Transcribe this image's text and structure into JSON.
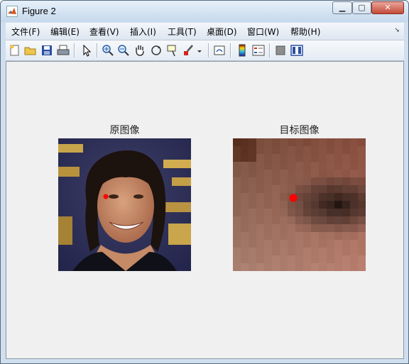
{
  "window": {
    "title": "Figure 2"
  },
  "menu": {
    "items": [
      "文件(F)",
      "编辑(E)",
      "查看(V)",
      "插入(I)",
      "工具(T)",
      "桌面(D)",
      "窗口(W)",
      "帮助(H)"
    ]
  },
  "toolbar_icons": [
    "new-figure-icon",
    "open-file-icon",
    "save-icon",
    "print-icon",
    "edit-plot-arrow-icon",
    "zoom-in-icon",
    "zoom-out-icon",
    "pan-hand-icon",
    "rotate-3d-icon",
    "data-cursor-icon",
    "brush-icon",
    "link-plot-icon",
    "colorbar-icon",
    "legend-icon",
    "hide-plot-tools-icon",
    "show-plot-tools-icon"
  ],
  "axes": [
    {
      "title": "原图像",
      "marker": {
        "color": "#ff0000"
      }
    },
    {
      "title": "目标图像",
      "marker": {
        "color": "#ff0000"
      }
    }
  ],
  "colors": {
    "figure_bg": "#f0f0f0",
    "marker": "#ff0000"
  }
}
